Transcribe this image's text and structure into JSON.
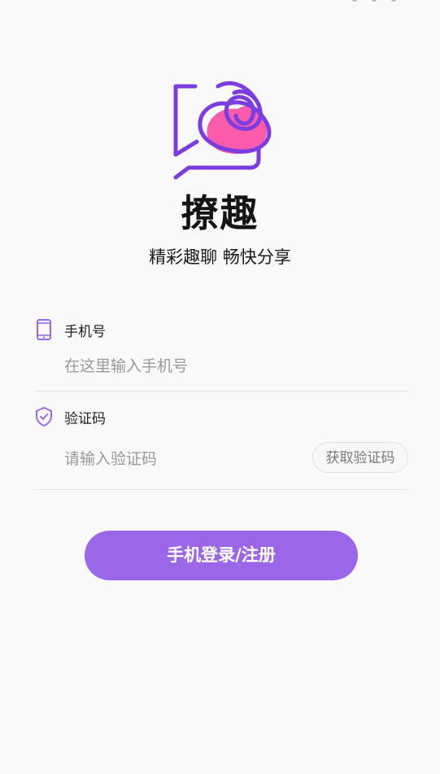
{
  "app": {
    "title": "撩趣",
    "slogan": "精彩趣聊 畅快分享",
    "logo_icon": "chat-bubble-rose-icon",
    "accent_color": "#9b67e9",
    "logo_fill_color": "#fb5bab",
    "logo_stroke_color": "#7b3de0"
  },
  "phone_field": {
    "icon": "phone-icon",
    "label": "手机号",
    "placeholder": "在这里输入手机号",
    "value": ""
  },
  "code_field": {
    "icon": "shield-check-icon",
    "label": "验证码",
    "placeholder": "请输入验证码",
    "value": "",
    "get_code_label": "获取验证码"
  },
  "actions": {
    "login_label": "手机登录/注册"
  }
}
